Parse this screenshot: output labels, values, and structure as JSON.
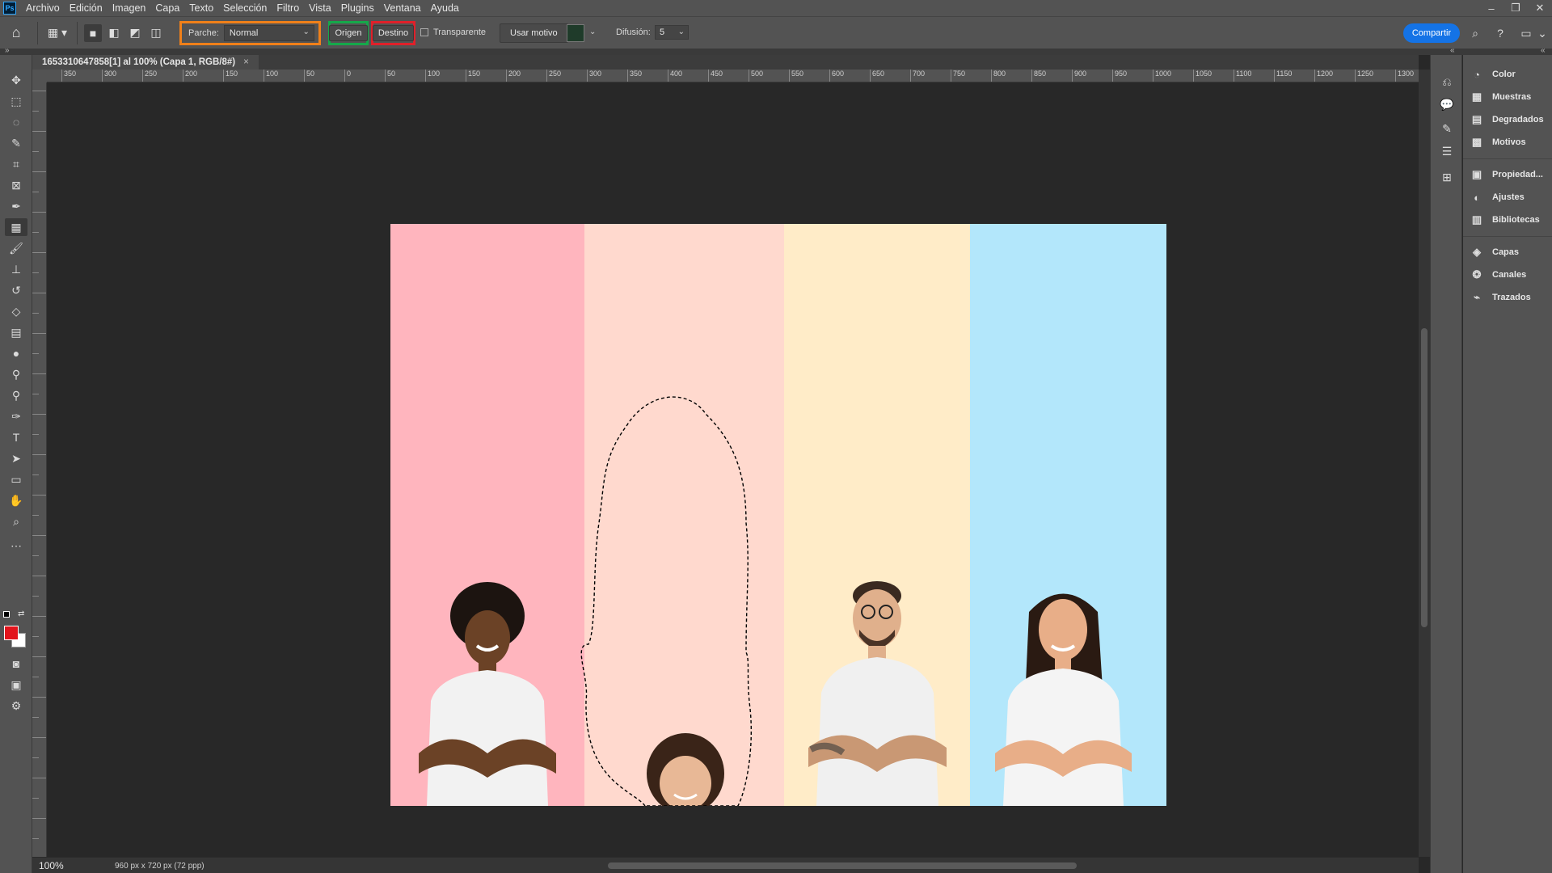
{
  "menu": [
    "Archivo",
    "Edición",
    "Imagen",
    "Capa",
    "Texto",
    "Selección",
    "Filtro",
    "Vista",
    "Plugins",
    "Ventana",
    "Ayuda"
  ],
  "app_logo": "Ps",
  "options": {
    "parche_label": "Parche:",
    "parche_value": "Normal",
    "origen": "Origen",
    "destino": "Destino",
    "transparente": "Transparente",
    "usar_motivo": "Usar motivo",
    "difusion_label": "Difusión:",
    "difusion_value": "5",
    "share": "Compartir"
  },
  "document": {
    "tab_title": "1653310647858[1] al 100% (Capa 1, RGB/8#)",
    "zoom": "100%",
    "info": "960 px x 720 px (72 ppp)"
  },
  "ruler_labels": [
    "350",
    "300",
    "250",
    "200",
    "150",
    "100",
    "50",
    "0",
    "50",
    "100",
    "150",
    "200",
    "250",
    "300",
    "350",
    "400",
    "450",
    "500",
    "550",
    "600",
    "650",
    "700",
    "750",
    "800",
    "850",
    "900",
    "950",
    "1000",
    "1050",
    "1100",
    "1150",
    "1200",
    "1250",
    "1300"
  ],
  "panels": [
    "Color",
    "Muestras",
    "Degradados",
    "Motivos",
    "Propiedad...",
    "Ajustes",
    "Bibliotecas",
    "Capas",
    "Canales",
    "Trazados"
  ],
  "colors": {
    "foreground": "#e2141c",
    "background": "#ffffff",
    "stripe_pink": "#ffb5be",
    "stripe_peach": "#ffd9ce",
    "stripe_cream": "#ffecc8",
    "stripe_blue": "#b3e7fb",
    "accent_share": "#1473e6",
    "highlight_orange": "#f08019",
    "highlight_green": "#15a84a",
    "highlight_red": "#e0202a"
  }
}
